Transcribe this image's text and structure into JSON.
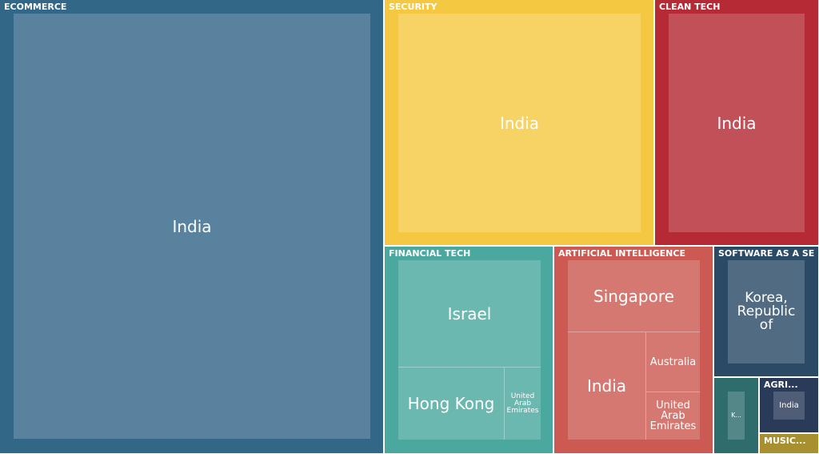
{
  "chart_data": {
    "type": "treemap",
    "groups": [
      {
        "id": "ecommerce",
        "name": "ECOMMERCE",
        "color": "#336788",
        "leaves": [
          {
            "label": "India"
          }
        ]
      },
      {
        "id": "security",
        "name": "SECURITY",
        "color": "#f5c842",
        "leaves": [
          {
            "label": "India"
          }
        ]
      },
      {
        "id": "cleantech",
        "name": "CLEAN TECH",
        "color": "#b52a35",
        "leaves": [
          {
            "label": "India"
          }
        ]
      },
      {
        "id": "fintech",
        "name": "FINANCIAL TECH",
        "color": "#4aa89f",
        "leaves": [
          {
            "label": "Israel"
          },
          {
            "label": "Hong Kong"
          },
          {
            "label": "United Arab Emirates"
          }
        ]
      },
      {
        "id": "ai",
        "name": "ARTIFICIAL INTELLIGENCE",
        "color": "#cc5a52",
        "leaves": [
          {
            "label": "Singapore"
          },
          {
            "label": "India"
          },
          {
            "label": "Australia"
          },
          {
            "label": "United Arab Emirates"
          }
        ]
      },
      {
        "id": "saas",
        "name": "SOFTWARE AS A SE...",
        "color": "#2b4a66",
        "leaves": [
          {
            "label": "Korea, Republic of"
          }
        ]
      },
      {
        "id": "teal-small",
        "name": "",
        "color": "#2f6d6d",
        "leaves": [
          {
            "label": "K..."
          }
        ]
      },
      {
        "id": "agri",
        "name": "AGRI...",
        "color": "#2a3a59",
        "leaves": [
          {
            "label": "India"
          }
        ]
      },
      {
        "id": "music",
        "name": "MUSIC...",
        "color": "#a89030",
        "leaves": []
      }
    ]
  }
}
